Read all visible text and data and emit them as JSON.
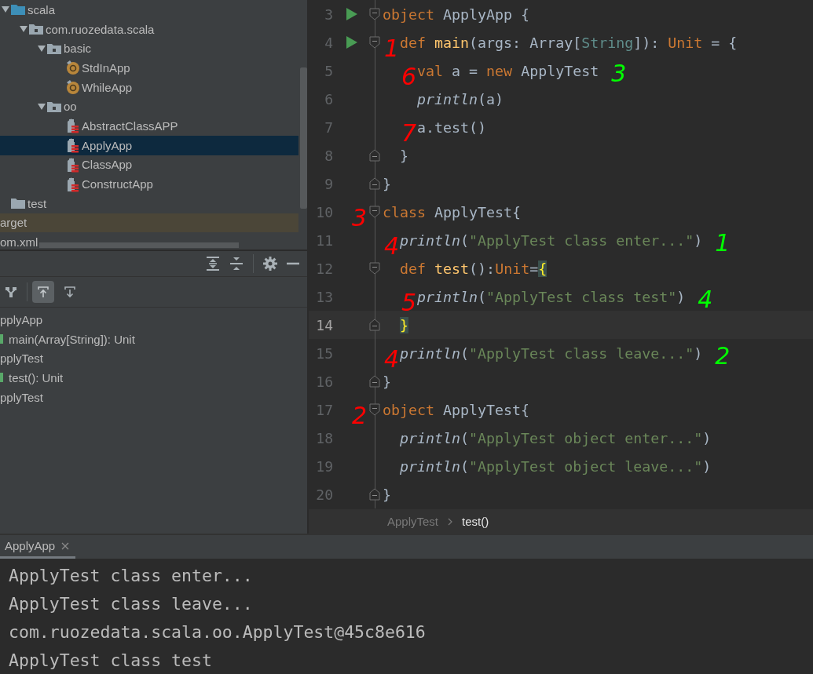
{
  "project": {
    "items": [
      {
        "label": "scala",
        "kind": "source-folder",
        "expanded": true,
        "selected": false,
        "children": [
          {
            "label": "com.ruozedata.scala",
            "kind": "package",
            "expanded": true,
            "selected": false,
            "children": [
              {
                "label": "basic",
                "kind": "package",
                "expanded": true,
                "selected": false,
                "children": [
                  {
                    "label": "StdInApp",
                    "kind": "object",
                    "selected": false
                  },
                  {
                    "label": "WhileApp",
                    "kind": "object",
                    "selected": false
                  }
                ]
              },
              {
                "label": "oo",
                "kind": "package",
                "expanded": true,
                "selected": false,
                "children": [
                  {
                    "label": "AbstractClassAPP",
                    "kind": "scala-file",
                    "selected": false
                  },
                  {
                    "label": "ApplyApp",
                    "kind": "scala-file",
                    "selected": true
                  },
                  {
                    "label": "ClassApp",
                    "kind": "scala-file",
                    "selected": false
                  },
                  {
                    "label": "ConstructApp",
                    "kind": "scala-file",
                    "selected": false
                  }
                ]
              }
            ]
          }
        ]
      },
      {
        "label": "test",
        "kind": "folder",
        "selected": false
      },
      {
        "label": "arget",
        "kind": "excluded-folder",
        "selected": false
      },
      {
        "label": "om.xml",
        "kind": "file",
        "selected": false
      }
    ]
  },
  "structure": {
    "tools": [
      {
        "kind": "hierarchy",
        "on": false
      },
      {
        "kind": "navigate-up",
        "on": true
      },
      {
        "kind": "navigate-down",
        "on": false
      }
    ],
    "items": [
      {
        "label": "pplyApp",
        "children": [
          {
            "label": "main(Array[String]): Unit",
            "kind": "method"
          }
        ]
      },
      {
        "label": "pplyTest",
        "children": [
          {
            "label": "test(): Unit",
            "kind": "method"
          }
        ]
      },
      {
        "label": "pplyTest"
      }
    ]
  },
  "editor": {
    "lines": [
      {
        "number": "3",
        "runnable": true,
        "current": false,
        "fold_start": true,
        "fold_end": false,
        "tokens": [
          {
            "text": "object",
            "kind": "kw"
          },
          {
            "text": " ApplyApp {",
            "kind": "id"
          }
        ]
      },
      {
        "number": "4",
        "runnable": true,
        "current": false,
        "fold_start": true,
        "fold_end": false,
        "notes": [
          {
            "text": "1",
            "color": "#ff0000",
            "kind": "left"
          }
        ],
        "tokens": [
          {
            "text": "  def",
            "kind": "kw"
          },
          {
            "text": " main",
            "kind": "fn"
          },
          {
            "text": "(args: Array[",
            "kind": "id"
          },
          {
            "text": "String",
            "kind": "type"
          },
          {
            "text": "]): ",
            "kind": "id"
          },
          {
            "text": "Unit",
            "kind": "kw"
          },
          {
            "text": " = {",
            "kind": "id"
          }
        ]
      },
      {
        "number": "5",
        "runnable": false,
        "current": false,
        "fold_start": false,
        "fold_end": false,
        "notes": [
          {
            "text": "6",
            "color": "#ff0000",
            "kind": "left"
          },
          {
            "text": "3",
            "color": "#00ff00",
            "kind": "right"
          }
        ],
        "tokens": [
          {
            "text": "    val",
            "kind": "kw"
          },
          {
            "text": " a = ",
            "kind": "id"
          },
          {
            "text": "new",
            "kind": "kw"
          },
          {
            "text": " ApplyTest",
            "kind": "id"
          }
        ]
      },
      {
        "number": "6",
        "runnable": false,
        "current": false,
        "fold_start": false,
        "fold_end": false,
        "tokens": [
          {
            "text": "    println",
            "kind": "call"
          },
          {
            "text": "(a)",
            "kind": "id"
          }
        ]
      },
      {
        "number": "7",
        "runnable": false,
        "current": false,
        "fold_start": false,
        "fold_end": false,
        "notes": [
          {
            "text": "7",
            "color": "#ff0000",
            "kind": "left"
          }
        ],
        "tokens": [
          {
            "text": "    a.test()",
            "kind": "id"
          }
        ]
      },
      {
        "number": "8",
        "runnable": false,
        "current": false,
        "fold_start": false,
        "fold_end": true,
        "tokens": [
          {
            "text": "  }",
            "kind": "id"
          }
        ]
      },
      {
        "number": "9",
        "runnable": false,
        "current": false,
        "fold_start": false,
        "fold_end": true,
        "tokens": [
          {
            "text": "}",
            "kind": "id"
          }
        ]
      },
      {
        "number": "10",
        "runnable": false,
        "current": false,
        "fold_start": true,
        "fold_end": false,
        "notes": [
          {
            "text": "3",
            "color": "#ff0000",
            "kind": "left"
          }
        ],
        "tokens": [
          {
            "text": "class",
            "kind": "kw"
          },
          {
            "text": " ApplyTest{",
            "kind": "id"
          }
        ]
      },
      {
        "number": "11",
        "runnable": false,
        "current": false,
        "fold_start": false,
        "fold_end": false,
        "notes": [
          {
            "text": "4",
            "color": "#ff0000",
            "kind": "left"
          },
          {
            "text": "1",
            "color": "#00ff00",
            "kind": "right"
          }
        ],
        "tokens": [
          {
            "text": "  println",
            "kind": "call"
          },
          {
            "text": "(",
            "kind": "id"
          },
          {
            "text": "\"ApplyTest class enter...\"",
            "kind": "str"
          },
          {
            "text": ")",
            "kind": "id"
          }
        ]
      },
      {
        "number": "12",
        "runnable": false,
        "current": false,
        "fold_start": true,
        "fold_end": false,
        "tokens": [
          {
            "text": "  def",
            "kind": "kw"
          },
          {
            "text": " test",
            "kind": "fn"
          },
          {
            "text": "():",
            "kind": "id"
          },
          {
            "text": "Unit",
            "kind": "kw"
          },
          {
            "text": "=",
            "kind": "id"
          },
          {
            "text": "{",
            "kind": "match"
          }
        ]
      },
      {
        "number": "13",
        "runnable": false,
        "current": false,
        "fold_start": false,
        "fold_end": false,
        "notes": [
          {
            "text": "5",
            "color": "#ff0000",
            "kind": "left"
          },
          {
            "text": "4",
            "color": "#00ff00",
            "kind": "right"
          }
        ],
        "tokens": [
          {
            "text": "    println",
            "kind": "call"
          },
          {
            "text": "(",
            "kind": "id"
          },
          {
            "text": "\"ApplyTest class test\"",
            "kind": "str"
          },
          {
            "text": ")",
            "kind": "id"
          }
        ]
      },
      {
        "number": "14",
        "runnable": false,
        "current": true,
        "fold_start": false,
        "fold_end": true,
        "tokens": [
          {
            "text": "  }",
            "kind": "match"
          }
        ]
      },
      {
        "number": "15",
        "runnable": false,
        "current": false,
        "fold_start": false,
        "fold_end": false,
        "notes": [
          {
            "text": "4",
            "color": "#ff0000",
            "kind": "left"
          },
          {
            "text": "2",
            "color": "#00ff00",
            "kind": "right"
          }
        ],
        "tokens": [
          {
            "text": "  println",
            "kind": "call"
          },
          {
            "text": "(",
            "kind": "id"
          },
          {
            "text": "\"ApplyTest class leave...\"",
            "kind": "str"
          },
          {
            "text": ")",
            "kind": "id"
          }
        ]
      },
      {
        "number": "16",
        "runnable": false,
        "current": false,
        "fold_start": false,
        "fold_end": true,
        "tokens": [
          {
            "text": "}",
            "kind": "id"
          }
        ]
      },
      {
        "number": "17",
        "runnable": false,
        "current": false,
        "fold_start": true,
        "fold_end": false,
        "notes": [
          {
            "text": "2",
            "color": "#ff0000",
            "kind": "left"
          }
        ],
        "tokens": [
          {
            "text": "object",
            "kind": "kw"
          },
          {
            "text": " ApplyTest{",
            "kind": "id"
          }
        ]
      },
      {
        "number": "18",
        "runnable": false,
        "current": false,
        "fold_start": false,
        "fold_end": false,
        "tokens": [
          {
            "text": "  println",
            "kind": "call"
          },
          {
            "text": "(",
            "kind": "id"
          },
          {
            "text": "\"ApplyTest object enter...\"",
            "kind": "str"
          },
          {
            "text": ")",
            "kind": "id"
          }
        ]
      },
      {
        "number": "19",
        "runnable": false,
        "current": false,
        "fold_start": false,
        "fold_end": false,
        "tokens": [
          {
            "text": "  println",
            "kind": "call"
          },
          {
            "text": "(",
            "kind": "id"
          },
          {
            "text": "\"ApplyTest object leave...\"",
            "kind": "str"
          },
          {
            "text": ")",
            "kind": "id"
          }
        ]
      },
      {
        "number": "20",
        "runnable": false,
        "current": false,
        "fold_start": false,
        "fold_end": true,
        "tokens": [
          {
            "text": "}",
            "kind": "id"
          }
        ]
      }
    ],
    "breadcrumbs": [
      {
        "label": "ApplyTest",
        "selected": false
      },
      {
        "label": "test()",
        "selected": true
      }
    ]
  },
  "run_panel": {
    "tabs": [
      {
        "label": "ApplyApp",
        "selected": true
      }
    ],
    "output": [
      "ApplyTest class enter...",
      "ApplyTest class leave...",
      "com.ruozedata.scala.oo.ApplyTest@45c8e616",
      "ApplyTest class test"
    ]
  }
}
